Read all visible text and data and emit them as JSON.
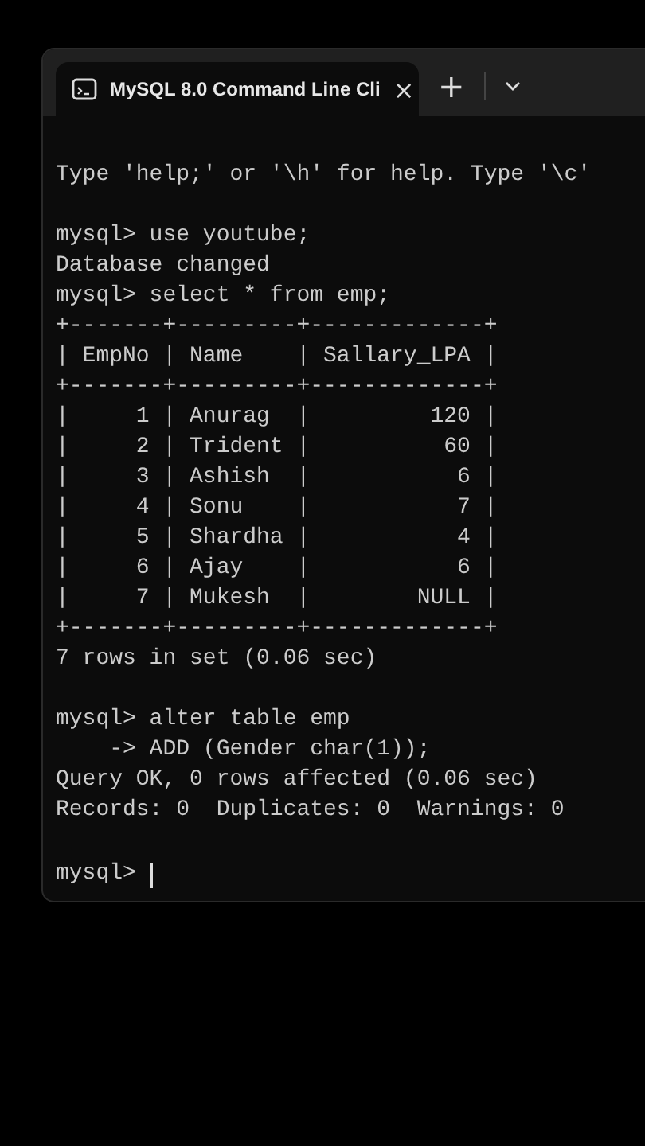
{
  "window": {
    "tab": {
      "title": "MySQL 8.0 Command Line Cli",
      "close": "×",
      "selected": true
    },
    "new_tab": "+"
  },
  "lines": [
    {
      "kind": "output",
      "text": "Type 'help;' or '\\h' for help. Type '\\c'"
    },
    {
      "kind": "blank"
    },
    {
      "kind": "output",
      "text": "mysql> use youtube;"
    },
    {
      "kind": "output",
      "text": "Database changed"
    },
    {
      "kind": "output",
      "text": "mysql> select * from emp;"
    },
    {
      "kind": "output",
      "text": "+-------+---------+-------------+"
    },
    {
      "kind": "output",
      "text": "| EmpNo | Name    | Sallary_LPA |"
    },
    {
      "kind": "output",
      "text": "+-------+---------+-------------+"
    },
    {
      "kind": "output",
      "text": "|     1 | Anurag  |         120 |"
    },
    {
      "kind": "output",
      "text": "|     2 | Trident |          60 |"
    },
    {
      "kind": "output",
      "text": "|     3 | Ashish  |           6 |"
    },
    {
      "kind": "output",
      "text": "|     4 | Sonu    |           7 |"
    },
    {
      "kind": "output",
      "text": "|     5 | Shardha |           4 |"
    },
    {
      "kind": "output",
      "text": "|     6 | Ajay    |           6 |"
    },
    {
      "kind": "output",
      "text": "|     7 | Mukesh  |        NULL |"
    },
    {
      "kind": "output",
      "text": "+-------+---------+-------------+"
    },
    {
      "kind": "output",
      "text": "7 rows in set (0.06 sec)"
    },
    {
      "kind": "blank"
    },
    {
      "kind": "output",
      "text": "mysql> alter table emp"
    },
    {
      "kind": "output",
      "text": "    -> ADD (Gender char(1));"
    },
    {
      "kind": "output",
      "text": "Query OK, 0 rows affected (0.06 sec)"
    },
    {
      "kind": "output",
      "text": "Records: 0  Duplicates: 0  Warnings: 0"
    },
    {
      "kind": "blank"
    },
    {
      "kind": "prompt",
      "text": "mysql> "
    }
  ]
}
